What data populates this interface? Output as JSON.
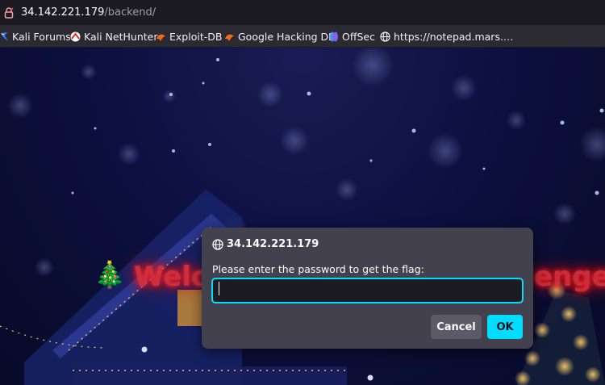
{
  "urlbar": {
    "host": "34.142.221.179",
    "path": "/backend/"
  },
  "bookmarks": [
    {
      "label": "Kali Forums",
      "icon": "kali-dragon-icon"
    },
    {
      "label": "Kali NetHunter",
      "icon": "nethunter-icon"
    },
    {
      "label": "Exploit-DB",
      "icon": "exploit-db-icon"
    },
    {
      "label": "Google Hacking DB",
      "icon": "ghdb-icon"
    },
    {
      "label": "OffSec",
      "icon": "offsec-icon"
    },
    {
      "label": "https://notepad.mars.…",
      "icon": "globe-icon"
    }
  ],
  "page": {
    "banner_left": "Welc",
    "banner_right": "enge",
    "tree": "🎄"
  },
  "dialog": {
    "origin": "34.142.221.179",
    "message": "Please enter the password to get the flag:",
    "input_value": "",
    "cancel_label": "Cancel",
    "ok_label": "OK"
  },
  "colors": {
    "accent": "#00ddff",
    "dialog_bg": "#42414d",
    "toolbar_bg": "#2b2a33",
    "urlbar_bg": "#1c1b22",
    "banner_red": "#e0303a"
  }
}
